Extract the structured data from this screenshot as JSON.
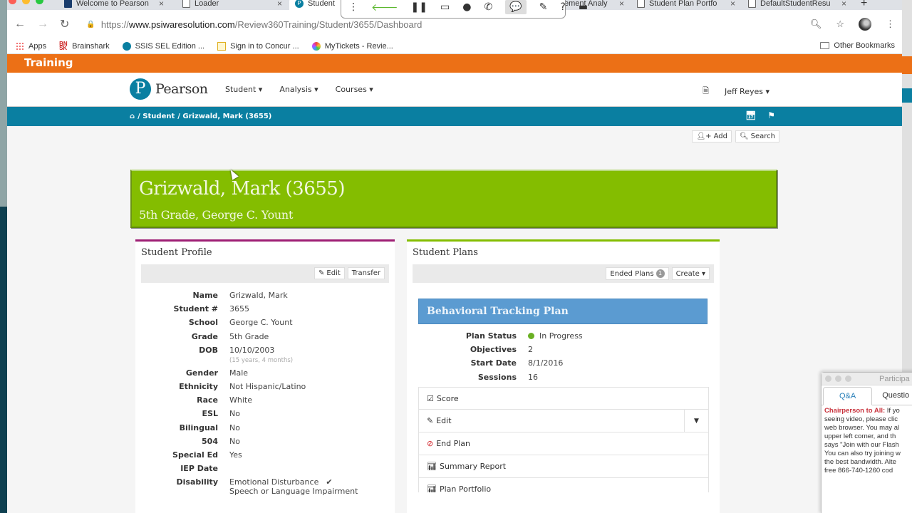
{
  "browser": {
    "tabs": [
      {
        "title": "Welcome to Pearson",
        "active": false
      },
      {
        "title": "Loader",
        "active": false
      },
      {
        "title": "Student",
        "active": true
      },
      {
        "title": "ement Analy",
        "active": false
      },
      {
        "title": "Student Plan Portfo",
        "active": false
      },
      {
        "title": "DefaultStudentResu",
        "active": false
      }
    ],
    "new_tab": "+",
    "close": "×",
    "url_scheme": "https://",
    "url_host": "www.psiwaresolution.com",
    "url_path": "/Review360Training/Student/3655/Dashboard",
    "bookmarks": [
      {
        "label": "Apps",
        "icon": "apps-grid-icon"
      },
      {
        "label": "Brainshark",
        "icon": "brainshark-icon"
      },
      {
        "label": "SSIS SEL Edition ...",
        "icon": "pearson-icon"
      },
      {
        "label": "Sign in to Concur ...",
        "icon": "concur-icon"
      },
      {
        "label": "MyTickets - Revie...",
        "icon": "mytickets-icon"
      }
    ],
    "other_bookmarks": "Other Bookmarks"
  },
  "meeting_toolbar": {
    "icons": [
      "more-icon",
      "back-arrow-icon",
      "pause-icon",
      "screen-share-icon",
      "user-icon",
      "phone-icon",
      "chat-icon",
      "pen-icon",
      "help-icon",
      "minimize-icon"
    ]
  },
  "app": {
    "env_label": "Training",
    "brand": "Pearson",
    "menu": [
      {
        "label": "Student ▾"
      },
      {
        "label": "Analysis ▾"
      },
      {
        "label": "Courses ▾"
      }
    ],
    "user": "Jeff Reyes ▾",
    "breadcrumb": [
      "/ Student",
      "/ Grizwald, Mark (3655)"
    ],
    "add_label": "Add",
    "search_label": "Search"
  },
  "student": {
    "heading": "Grizwald, Mark (3655)",
    "subheading": "5th Grade, George C. Yount"
  },
  "profile": {
    "title": "Student Profile",
    "edit_label": "Edit",
    "transfer_label": "Transfer",
    "fields": [
      {
        "label": "Name",
        "value": "Grizwald, Mark"
      },
      {
        "label": "Student #",
        "value": "3655"
      },
      {
        "label": "School",
        "value": "George C. Yount"
      },
      {
        "label": "Grade",
        "value": "5th Grade"
      },
      {
        "label": "DOB",
        "value": "10/10/2003",
        "note": "(15 years, 4 months)"
      },
      {
        "label": "Gender",
        "value": "Male"
      },
      {
        "label": "Ethnicity",
        "value": "Not Hispanic/Latino"
      },
      {
        "label": "Race",
        "value": "White"
      },
      {
        "label": "ESL",
        "value": "No"
      },
      {
        "label": "Bilingual",
        "value": "No"
      },
      {
        "label": "504",
        "value": "No"
      },
      {
        "label": "Special Ed",
        "value": "Yes"
      },
      {
        "label": "IEP Date",
        "value": ""
      },
      {
        "label": "Disability",
        "value": "Emotional Disturbance",
        "value2": "Speech or Language Impairment"
      }
    ],
    "check": "✔"
  },
  "plans": {
    "title": "Student Plans",
    "ended_plans_label": "Ended Plans",
    "ended_plans_count": "1",
    "create_label": "Create ▾",
    "plan": {
      "name": "Behavioral Tracking Plan",
      "fields": [
        {
          "label": "Plan Status",
          "value": "In Progress"
        },
        {
          "label": "Objectives",
          "value": "2"
        },
        {
          "label": "Start Date",
          "value": "8/1/2016"
        },
        {
          "label": "Sessions",
          "value": "16"
        }
      ],
      "status_color": "#6ab023",
      "actions": [
        {
          "label": "Score",
          "icon": "checkbox-icon"
        },
        {
          "label": "Edit",
          "icon": "edit-icon"
        },
        {
          "label": "End Plan",
          "icon": "ban-icon"
        },
        {
          "label": "Summary Report",
          "icon": "bar-chart-icon"
        },
        {
          "label": "Plan Portfolio",
          "icon": "bar-chart-icon"
        }
      ]
    }
  },
  "participants": {
    "title": "Participa",
    "tabs": [
      "Q&A",
      "Questio"
    ],
    "sender": "Chairperson to All:",
    "lines": [
      " If yo",
      "seeing video, please clic",
      "web browser. You may al",
      "upper left corner, and th",
      "says \"Join with our Flash",
      "You can also try joining w",
      "the best bandwidth. Alte",
      "free 866-740-1260 cod"
    ]
  },
  "colors": {
    "env_bar": "#ec7016",
    "nav_blue": "#0a7fa1",
    "hero_green": "#84bd00",
    "profile_accent": "#9e1e74",
    "plan_header": "#5b9bd1"
  }
}
